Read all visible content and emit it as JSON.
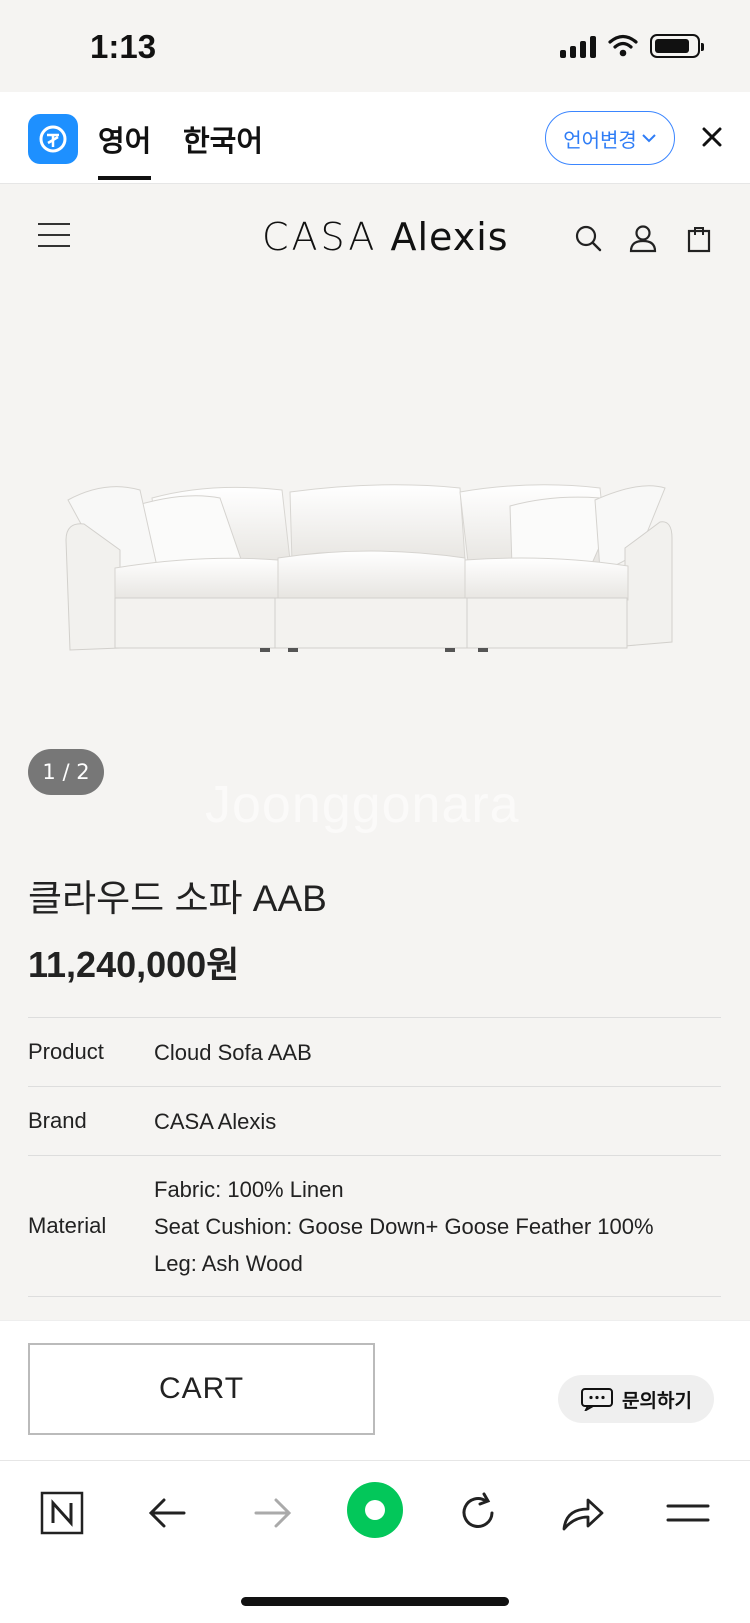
{
  "status_bar": {
    "time": "1:13",
    "battery_level": 0.85
  },
  "translate_bar": {
    "tabs": [
      {
        "label": "영어",
        "active": true
      },
      {
        "label": "한국어",
        "active": false
      }
    ],
    "change_language_label": "언어변경",
    "accent_color": "#2f7df6"
  },
  "site_header": {
    "brand_light": "CASA",
    "brand_bold": "Alexis"
  },
  "gallery": {
    "page_indicator": "1 / 2",
    "watermark": "Joonggonara"
  },
  "product": {
    "title": "클라우드 소파 AAB",
    "price": "11,240,000원"
  },
  "specs": [
    {
      "key": "Product",
      "values": [
        "Cloud Sofa AAB"
      ]
    },
    {
      "key": "Brand",
      "values": [
        "CASA Alexis"
      ]
    },
    {
      "key": "Material",
      "values": [
        "Fabric: 100% Linen",
        "Seat Cushion: Goose Down+ Goose Feather 100%",
        "Leg: Ash Wood"
      ]
    }
  ],
  "actions": {
    "cart_label": "CART",
    "inquiry_label": "문의하기"
  },
  "browser_bar": {
    "icons": [
      "naver-n-icon",
      "back-arrow-icon",
      "forward-arrow-icon",
      "green-dot-icon",
      "reload-icon",
      "share-icon",
      "menu-lines-icon"
    ],
    "brand_color": "#03c75a"
  }
}
